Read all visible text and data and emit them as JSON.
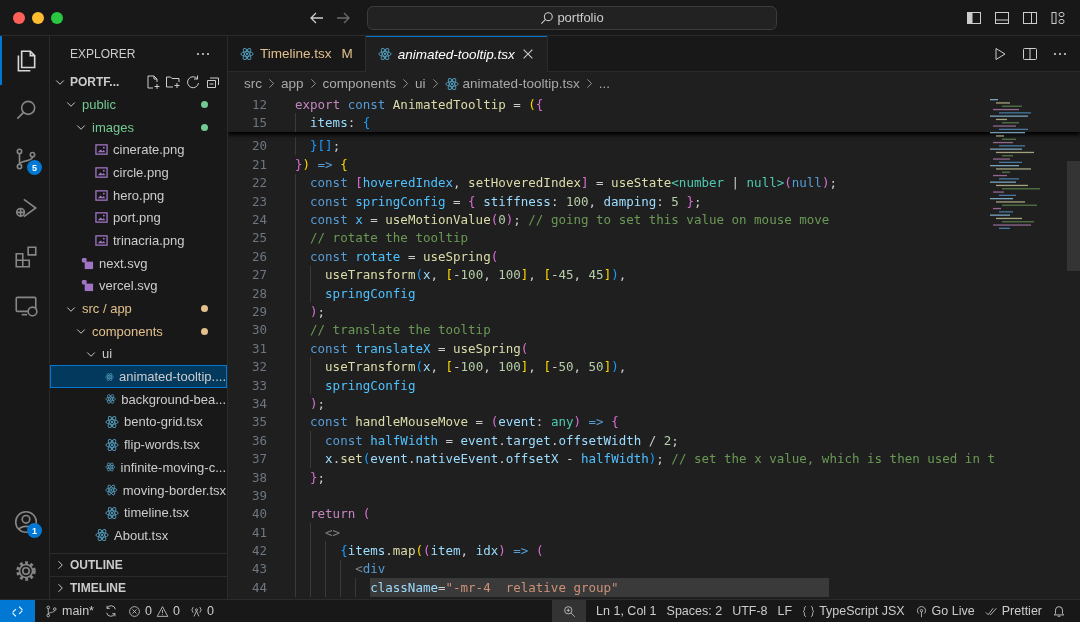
{
  "window": {
    "search": "portfolio"
  },
  "activity_bar": {
    "top": [
      {
        "kind": "explorer",
        "selected": true
      },
      {
        "kind": "search",
        "selected": false
      },
      {
        "kind": "source-control",
        "selected": false,
        "badge": "5"
      },
      {
        "kind": "run-debug",
        "selected": false
      },
      {
        "kind": "extensions",
        "selected": false
      },
      {
        "kind": "remote",
        "selected": false
      }
    ],
    "bottom": [
      {
        "kind": "accounts",
        "selected": false,
        "badge": "1"
      },
      {
        "kind": "settings",
        "selected": false
      }
    ]
  },
  "explorer": {
    "title": "EXPLORER",
    "sections": [
      {
        "label": "PORTF...",
        "expanded": true,
        "tree": [
          {
            "label": "public",
            "kind": "folder",
            "expanded": true,
            "selected": false,
            "color": "#73c991",
            "children": [
              {
                "label": "images",
                "kind": "folder",
                "expanded": true,
                "selected": false,
                "color": "#73c991",
                "children": [
                  {
                    "label": "cinerate.png",
                    "kind": "image",
                    "selected": false
                  },
                  {
                    "label": "circle.png",
                    "kind": "image",
                    "selected": false
                  },
                  {
                    "label": "hero.png",
                    "kind": "image",
                    "selected": false
                  },
                  {
                    "label": "port.png",
                    "kind": "image",
                    "selected": false
                  },
                  {
                    "label": "trinacria.png",
                    "kind": "image",
                    "selected": false
                  }
                ]
              },
              {
                "label": "next.svg",
                "kind": "svg",
                "selected": false
              },
              {
                "label": "vercel.svg",
                "kind": "svg",
                "selected": false
              }
            ]
          },
          {
            "label": "src / app",
            "kind": "folder",
            "expanded": true,
            "selected": false,
            "color": "#e2c08d",
            "children": [
              {
                "label": "components",
                "kind": "folder",
                "expanded": true,
                "selected": false,
                "color": "#e2c08d",
                "children": [
                  {
                    "label": "ui",
                    "kind": "folder",
                    "expanded": true,
                    "selected": false,
                    "children": [
                      {
                        "label": "animated-tooltip....",
                        "kind": "react",
                        "selected": true
                      },
                      {
                        "label": "background-bea...",
                        "kind": "react",
                        "selected": false
                      },
                      {
                        "label": "bento-grid.tsx",
                        "kind": "react",
                        "selected": false
                      },
                      {
                        "label": "flip-words.tsx",
                        "kind": "react",
                        "selected": false
                      },
                      {
                        "label": "infinite-moving-c...",
                        "kind": "react",
                        "selected": false
                      },
                      {
                        "label": "moving-border.tsx",
                        "kind": "react",
                        "selected": false
                      },
                      {
                        "label": "timeline.tsx",
                        "kind": "react",
                        "selected": false
                      }
                    ]
                  },
                  {
                    "label": "About.tsx",
                    "kind": "react",
                    "selected": false
                  }
                ]
              }
            ]
          }
        ]
      },
      {
        "label": "OUTLINE",
        "expanded": false
      },
      {
        "label": "TIMELINE",
        "expanded": false
      }
    ]
  },
  "tabs": [
    {
      "label": "Timeline.tsx",
      "decoration": "M",
      "selected": false,
      "preview": false
    },
    {
      "label": "animated-tooltip.tsx",
      "selected": true,
      "preview": true
    }
  ],
  "breadcrumbs": [
    {
      "label": "src",
      "kind": "folder"
    },
    {
      "label": "app",
      "kind": "folder"
    },
    {
      "label": "components",
      "kind": "folder"
    },
    {
      "label": "ui",
      "kind": "folder"
    },
    {
      "label": "animated-tooltip.tsx",
      "kind": "file"
    },
    {
      "label": "...",
      "kind": "more"
    }
  ],
  "editor": {
    "sticky_lines": [
      {
        "number": "12",
        "tokens": [
          {
            "text": "export",
            "kind": "control"
          },
          {
            "text": " const",
            "kind": "keyword"
          },
          {
            "text": " AnimatedTooltip",
            "kind": "function"
          },
          {
            "text": " = ",
            "kind": "plain"
          },
          {
            "text": "(",
            "kind": "bracket1"
          },
          {
            "text": "{",
            "kind": "bracket2"
          }
        ],
        "children": [
          {
            "number": "15",
            "tokens": [
              {
                "text": "items",
                "kind": "variable"
              },
              {
                "text": ": ",
                "kind": "plain"
              },
              {
                "text": "{",
                "kind": "bracket3"
              }
            ]
          }
        ]
      }
    ],
    "lines": [
      {
        "children": [
          {
            "number": "20",
            "tokens": [
              {
                "text": "}[]",
                "kind": "bracket3"
              },
              {
                "text": ";",
                "kind": "plain"
              }
            ]
          }
        ]
      },
      {
        "number": "21",
        "tokens": [
          {
            "text": "}",
            "kind": "bracket2"
          },
          {
            "text": ")",
            "kind": "bracket1"
          },
          {
            "text": " => ",
            "kind": "keyword"
          },
          {
            "text": "{",
            "kind": "bracket1"
          }
        ],
        "children": [
          {
            "number": "22",
            "tokens": [
              {
                "text": "const ",
                "kind": "keyword"
              },
              {
                "text": "[",
                "kind": "bracket2"
              },
              {
                "text": "hoveredIndex",
                "kind": "constant"
              },
              {
                "text": ", ",
                "kind": "plain"
              },
              {
                "text": "setHoveredIndex",
                "kind": "function"
              },
              {
                "text": "]",
                "kind": "bracket2"
              },
              {
                "text": " = ",
                "kind": "plain"
              },
              {
                "text": "useState",
                "kind": "function"
              },
              {
                "text": "<number",
                "kind": "type"
              },
              {
                "text": " | ",
                "kind": "plain"
              },
              {
                "text": "null>",
                "kind": "type"
              },
              {
                "text": "(",
                "kind": "bracket2"
              },
              {
                "text": "null",
                "kind": "keyword"
              },
              {
                "text": ")",
                "kind": "bracket2"
              },
              {
                "text": ";",
                "kind": "plain"
              }
            ]
          },
          {
            "number": "23",
            "tokens": [
              {
                "text": "const ",
                "kind": "keyword"
              },
              {
                "text": "springConfig",
                "kind": "constant"
              },
              {
                "text": " = ",
                "kind": "plain"
              },
              {
                "text": "{",
                "kind": "bracket2"
              },
              {
                "text": " stiffness",
                "kind": "variable"
              },
              {
                "text": ": ",
                "kind": "plain"
              },
              {
                "text": "100",
                "kind": "number"
              },
              {
                "text": ", ",
                "kind": "plain"
              },
              {
                "text": "damping",
                "kind": "variable"
              },
              {
                "text": ": ",
                "kind": "plain"
              },
              {
                "text": "5",
                "kind": "number"
              },
              {
                "text": " }",
                "kind": "bracket2"
              },
              {
                "text": ";",
                "kind": "plain"
              }
            ]
          },
          {
            "number": "24",
            "tokens": [
              {
                "text": "const ",
                "kind": "keyword"
              },
              {
                "text": "x",
                "kind": "constant"
              },
              {
                "text": " = ",
                "kind": "plain"
              },
              {
                "text": "useMotionValue",
                "kind": "function"
              },
              {
                "text": "(",
                "kind": "bracket2"
              },
              {
                "text": "0",
                "kind": "number"
              },
              {
                "text": ")",
                "kind": "bracket2"
              },
              {
                "text": "; ",
                "kind": "plain"
              },
              {
                "text": "// going to set this value on mouse move",
                "kind": "comment"
              }
            ]
          },
          {
            "number": "25",
            "tokens": [
              {
                "text": "// rotate the tooltip",
                "kind": "comment"
              }
            ]
          },
          {
            "number": "26",
            "tokens": [
              {
                "text": "const ",
                "kind": "keyword"
              },
              {
                "text": "rotate",
                "kind": "constant"
              },
              {
                "text": " = ",
                "kind": "plain"
              },
              {
                "text": "useSpring",
                "kind": "function"
              },
              {
                "text": "(",
                "kind": "bracket2"
              }
            ],
            "children": [
              {
                "number": "27",
                "tokens": [
                  {
                    "text": "useTransform",
                    "kind": "function"
                  },
                  {
                    "text": "(",
                    "kind": "bracket3"
                  },
                  {
                    "text": "x",
                    "kind": "variable"
                  },
                  {
                    "text": ", ",
                    "kind": "plain"
                  },
                  {
                    "text": "[",
                    "kind": "bracket1"
                  },
                  {
                    "text": "-",
                    "kind": "plain"
                  },
                  {
                    "text": "100",
                    "kind": "number"
                  },
                  {
                    "text": ", ",
                    "kind": "plain"
                  },
                  {
                    "text": "100",
                    "kind": "number"
                  },
                  {
                    "text": "]",
                    "kind": "bracket1"
                  },
                  {
                    "text": ", ",
                    "kind": "plain"
                  },
                  {
                    "text": "[",
                    "kind": "bracket1"
                  },
                  {
                    "text": "-",
                    "kind": "plain"
                  },
                  {
                    "text": "45",
                    "kind": "number"
                  },
                  {
                    "text": ", ",
                    "kind": "plain"
                  },
                  {
                    "text": "45",
                    "kind": "number"
                  },
                  {
                    "text": "]",
                    "kind": "bracket1"
                  },
                  {
                    "text": ")",
                    "kind": "bracket3"
                  },
                  {
                    "text": ",",
                    "kind": "plain"
                  }
                ]
              },
              {
                "number": "28",
                "tokens": [
                  {
                    "text": "springConfig",
                    "kind": "constant"
                  }
                ]
              }
            ]
          },
          {
            "number": "29",
            "tokens": [
              {
                "text": ")",
                "kind": "bracket2"
              },
              {
                "text": ";",
                "kind": "plain"
              }
            ]
          },
          {
            "number": "30",
            "tokens": [
              {
                "text": "// translate the tooltip",
                "kind": "comment"
              }
            ]
          },
          {
            "number": "31",
            "tokens": [
              {
                "text": "const ",
                "kind": "keyword"
              },
              {
                "text": "translateX",
                "kind": "constant"
              },
              {
                "text": " = ",
                "kind": "plain"
              },
              {
                "text": "useSpring",
                "kind": "function"
              },
              {
                "text": "(",
                "kind": "bracket2"
              }
            ],
            "children": [
              {
                "number": "32",
                "tokens": [
                  {
                    "text": "useTransform",
                    "kind": "function"
                  },
                  {
                    "text": "(",
                    "kind": "bracket3"
                  },
                  {
                    "text": "x",
                    "kind": "variable"
                  },
                  {
                    "text": ", ",
                    "kind": "plain"
                  },
                  {
                    "text": "[",
                    "kind": "bracket1"
                  },
                  {
                    "text": "-",
                    "kind": "plain"
                  },
                  {
                    "text": "100",
                    "kind": "number"
                  },
                  {
                    "text": ", ",
                    "kind": "plain"
                  },
                  {
                    "text": "100",
                    "kind": "number"
                  },
                  {
                    "text": "]",
                    "kind": "bracket1"
                  },
                  {
                    "text": ", ",
                    "kind": "plain"
                  },
                  {
                    "text": "[",
                    "kind": "bracket1"
                  },
                  {
                    "text": "-",
                    "kind": "plain"
                  },
                  {
                    "text": "50",
                    "kind": "number"
                  },
                  {
                    "text": ", ",
                    "kind": "plain"
                  },
                  {
                    "text": "50",
                    "kind": "number"
                  },
                  {
                    "text": "]",
                    "kind": "bracket1"
                  },
                  {
                    "text": ")",
                    "kind": "bracket3"
                  },
                  {
                    "text": ",",
                    "kind": "plain"
                  }
                ]
              },
              {
                "number": "33",
                "tokens": [
                  {
                    "text": "springConfig",
                    "kind": "constant"
                  }
                ]
              }
            ]
          },
          {
            "number": "34",
            "tokens": [
              {
                "text": ")",
                "kind": "bracket2"
              },
              {
                "text": ";",
                "kind": "plain"
              }
            ]
          },
          {
            "number": "35",
            "tokens": [
              {
                "text": "const ",
                "kind": "keyword"
              },
              {
                "text": "handleMouseMove",
                "kind": "function"
              },
              {
                "text": " = ",
                "kind": "plain"
              },
              {
                "text": "(",
                "kind": "bracket2"
              },
              {
                "text": "event",
                "kind": "variable"
              },
              {
                "text": ": ",
                "kind": "plain"
              },
              {
                "text": "any",
                "kind": "type"
              },
              {
                "text": ")",
                "kind": "bracket2"
              },
              {
                "text": " => ",
                "kind": "keyword"
              },
              {
                "text": "{",
                "kind": "bracket2"
              }
            ],
            "children": [
              {
                "number": "36",
                "tokens": [
                  {
                    "text": "const ",
                    "kind": "keyword"
                  },
                  {
                    "text": "halfWidth",
                    "kind": "constant"
                  },
                  {
                    "text": " = ",
                    "kind": "plain"
                  },
                  {
                    "text": "event",
                    "kind": "variable"
                  },
                  {
                    "text": ".",
                    "kind": "plain"
                  },
                  {
                    "text": "target",
                    "kind": "variable"
                  },
                  {
                    "text": ".",
                    "kind": "plain"
                  },
                  {
                    "text": "offsetWidth",
                    "kind": "variable"
                  },
                  {
                    "text": " / ",
                    "kind": "plain"
                  },
                  {
                    "text": "2",
                    "kind": "number"
                  },
                  {
                    "text": ";",
                    "kind": "plain"
                  }
                ]
              },
              {
                "number": "37",
                "tokens": [
                  {
                    "text": "x",
                    "kind": "variable"
                  },
                  {
                    "text": ".",
                    "kind": "plain"
                  },
                  {
                    "text": "set",
                    "kind": "function"
                  },
                  {
                    "text": "(",
                    "kind": "bracket3"
                  },
                  {
                    "text": "event",
                    "kind": "variable"
                  },
                  {
                    "text": ".",
                    "kind": "plain"
                  },
                  {
                    "text": "nativeEvent",
                    "kind": "variable"
                  },
                  {
                    "text": ".",
                    "kind": "plain"
                  },
                  {
                    "text": "offsetX",
                    "kind": "variable"
                  },
                  {
                    "text": " - ",
                    "kind": "plain"
                  },
                  {
                    "text": "halfWidth",
                    "kind": "constant"
                  },
                  {
                    "text": ")",
                    "kind": "bracket3"
                  },
                  {
                    "text": "; ",
                    "kind": "plain"
                  },
                  {
                    "text": "// set the x value, which is then used in t",
                    "kind": "comment"
                  }
                ]
              }
            ]
          },
          {
            "number": "38",
            "tokens": [
              {
                "text": "}",
                "kind": "bracket2"
              },
              {
                "text": ";",
                "kind": "plain"
              }
            ]
          },
          {
            "number": "39"
          },
          {
            "number": "40",
            "tokens": [
              {
                "text": "return",
                "kind": "control"
              },
              {
                "text": " (",
                "kind": "bracket2"
              }
            ],
            "children": [
              {
                "number": "41",
                "tokens": [
                  {
                    "text": "<>",
                    "kind": "tag"
                  }
                ],
                "children": [
                  {
                    "number": "42",
                    "tokens": [
                      {
                        "text": "{",
                        "kind": "bracket3"
                      },
                      {
                        "text": "items",
                        "kind": "variable"
                      },
                      {
                        "text": ".",
                        "kind": "plain"
                      },
                      {
                        "text": "map",
                        "kind": "function"
                      },
                      {
                        "text": "(",
                        "kind": "bracket1"
                      },
                      {
                        "text": "(",
                        "kind": "bracket2"
                      },
                      {
                        "text": "item",
                        "kind": "variable"
                      },
                      {
                        "text": ", ",
                        "kind": "plain"
                      },
                      {
                        "text": "idx",
                        "kind": "variable"
                      },
                      {
                        "text": ")",
                        "kind": "bracket2"
                      },
                      {
                        "text": " => ",
                        "kind": "keyword"
                      },
                      {
                        "text": "(",
                        "kind": "bracket2"
                      }
                    ],
                    "children": [
                      {
                        "number": "43",
                        "tokens": [
                          {
                            "text": "<",
                            "kind": "tag"
                          },
                          {
                            "text": "div",
                            "kind": "keyword"
                          }
                        ],
                        "children": [
                          {
                            "number": "44",
                            "highlighted": true,
                            "tokens": [
                              {
                                "text": "className",
                                "kind": "variable"
                              },
                              {
                                "text": "=",
                                "kind": "plain"
                              },
                              {
                                "text": "\"-mr-4  relative group\"",
                                "kind": "string"
                              }
                            ]
                          }
                        ]
                      }
                    ]
                  }
                ]
              }
            ]
          }
        ]
      }
    ]
  },
  "status_bar": {
    "branch": "main*",
    "errors": "0",
    "warnings": "0",
    "ports": "0",
    "items": [
      {
        "text": "Ln 1, Col 1",
        "kind": "plain"
      },
      {
        "text": "Spaces: 2",
        "kind": "plain"
      },
      {
        "text": "UTF-8",
        "kind": "plain"
      },
      {
        "text": "LF",
        "kind": "plain"
      },
      {
        "text": "TypeScript JSX",
        "kind": "language"
      },
      {
        "text": "Go Live",
        "kind": "live"
      },
      {
        "text": "Prettier",
        "kind": "formatter"
      }
    ]
  }
}
